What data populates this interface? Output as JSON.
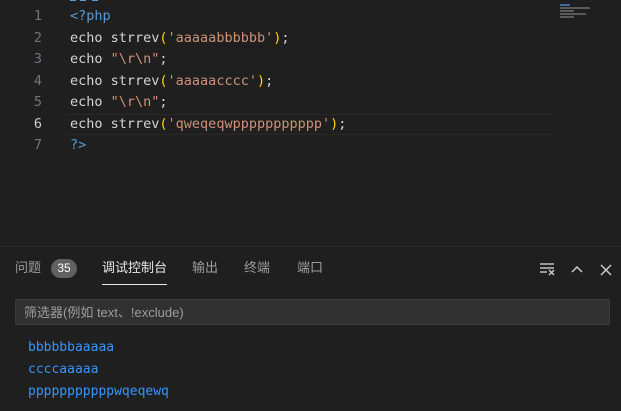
{
  "editor": {
    "active_line": 6,
    "lines": [
      {
        "num": "1",
        "parts": [
          {
            "t": "<?php",
            "c": "tag"
          }
        ]
      },
      {
        "num": "2",
        "parts": [
          {
            "t": "echo strrev",
            "c": "plain"
          },
          {
            "t": "(",
            "c": "paren"
          },
          {
            "t": "'aaaaabbbbbb'",
            "c": "str"
          },
          {
            "t": ")",
            "c": "paren"
          },
          {
            "t": ";",
            "c": "plain"
          }
        ]
      },
      {
        "num": "3",
        "parts": [
          {
            "t": "echo ",
            "c": "plain"
          },
          {
            "t": "\"\\r\\n\"",
            "c": "str"
          },
          {
            "t": ";",
            "c": "plain"
          }
        ]
      },
      {
        "num": "4",
        "parts": [
          {
            "t": "echo strrev",
            "c": "plain"
          },
          {
            "t": "(",
            "c": "paren"
          },
          {
            "t": "'aaaaacccc'",
            "c": "str"
          },
          {
            "t": ")",
            "c": "paren"
          },
          {
            "t": ";",
            "c": "plain"
          }
        ]
      },
      {
        "num": "5",
        "parts": [
          {
            "t": "echo ",
            "c": "plain"
          },
          {
            "t": "\"\\r\\n\"",
            "c": "str"
          },
          {
            "t": ";",
            "c": "plain"
          }
        ]
      },
      {
        "num": "6",
        "parts": [
          {
            "t": "echo strrev",
            "c": "plain"
          },
          {
            "t": "(",
            "c": "paren"
          },
          {
            "t": "'qweqeqwppppppppppp'",
            "c": "str"
          },
          {
            "t": ")",
            "c": "paren"
          },
          {
            "t": ";",
            "c": "plain"
          }
        ]
      },
      {
        "num": "7",
        "parts": [
          {
            "t": "?>",
            "c": "tag"
          }
        ]
      }
    ]
  },
  "panel": {
    "tabs": [
      {
        "label": "问题",
        "name": "tab-problems"
      },
      {
        "label": "调试控制台",
        "name": "tab-debug-console"
      },
      {
        "label": "输出",
        "name": "tab-output"
      },
      {
        "label": "终端",
        "name": "tab-terminal"
      },
      {
        "label": "端口",
        "name": "tab-ports"
      }
    ],
    "problems_count": "35",
    "active_tab": "调试控制台",
    "filter_placeholder": "筛选器(例如 text、!exclude)",
    "icons": [
      "clear-console-icon",
      "chevron-up-icon",
      "close-icon"
    ],
    "output_lines": [
      "bbbbbbaaaaa",
      "ccccaaaaa",
      "pppppppppppwqeqewq"
    ]
  },
  "colors": {
    "background": "#1f1f1f",
    "keyword": "#569cd6",
    "string": "#ce9178",
    "bracket": "#ffd700",
    "text": "#d4d4d4",
    "output": "#3794ff"
  }
}
